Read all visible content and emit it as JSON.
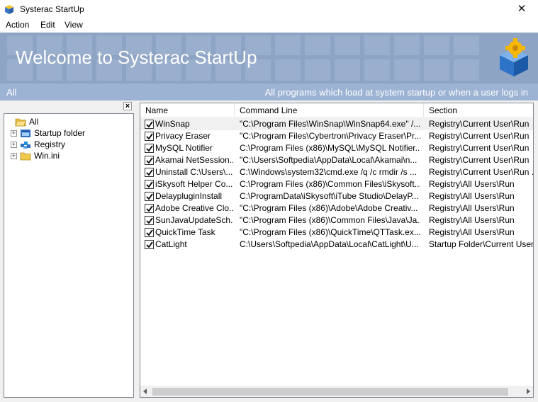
{
  "window": {
    "title": "Systerac StartUp",
    "close_label": "✕"
  },
  "menu": [
    "Action",
    "Edit",
    "View"
  ],
  "banner": {
    "title": "Welcome to Systerac StartUp",
    "bg_color": "#8ea4c4"
  },
  "subbar": {
    "left": "All",
    "right": "All programs which load at system startup or when a user logs in"
  },
  "tree": {
    "close_label": "×",
    "items": [
      {
        "label": "All",
        "icon": "folder-open-icon",
        "expandable": false
      },
      {
        "label": "Startup folder",
        "icon": "startup-folder-icon",
        "expandable": true
      },
      {
        "label": "Registry",
        "icon": "registry-icon",
        "expandable": true
      },
      {
        "label": "Win.ini",
        "icon": "folder-icon",
        "expandable": true
      }
    ]
  },
  "list": {
    "columns": [
      "Name",
      "Command Line",
      "Section"
    ],
    "rows": [
      {
        "checked": true,
        "name": "WinSnap",
        "command": "\"C:\\Program Files\\WinSnap\\WinSnap64.exe\" /...",
        "section": "Registry\\Current User\\Run"
      },
      {
        "checked": true,
        "name": "Privacy Eraser",
        "command": "\"C:\\Program Files\\Cybertron\\Privacy Eraser\\Pr...",
        "section": "Registry\\Current User\\Run"
      },
      {
        "checked": true,
        "name": "MySQL Notifier",
        "command": "C:\\Program Files (x86)\\MySQL\\MySQL Notifier...",
        "section": "Registry\\Current User\\Run"
      },
      {
        "checked": true,
        "name": "Akamai NetSession...",
        "command": "\"C:\\Users\\Softpedia\\AppData\\Local\\Akamai\\n...",
        "section": "Registry\\Current User\\Run"
      },
      {
        "checked": true,
        "name": "Uninstall C:\\Users\\...",
        "command": "C:\\Windows\\system32\\cmd.exe /q /c rmdir /s ...",
        "section": "Registry\\Current User\\Run ..."
      },
      {
        "checked": true,
        "name": "iSkysoft Helper Co...",
        "command": "C:\\Program Files (x86)\\Common Files\\iSkysoft...",
        "section": "Registry\\All Users\\Run"
      },
      {
        "checked": true,
        "name": "DelaypluginInstall",
        "command": "C:\\ProgramData\\iSkysoft\\iTube Studio\\DelayP...",
        "section": "Registry\\All Users\\Run"
      },
      {
        "checked": true,
        "name": "Adobe Creative Clo...",
        "command": "\"C:\\Program Files (x86)\\Adobe\\Adobe Creativ...",
        "section": "Registry\\All Users\\Run"
      },
      {
        "checked": true,
        "name": "SunJavaUpdateSch...",
        "command": "\"C:\\Program Files (x86)\\Common Files\\Java\\Ja...",
        "section": "Registry\\All Users\\Run"
      },
      {
        "checked": true,
        "name": "QuickTime Task",
        "command": "\"C:\\Program Files (x86)\\QuickTime\\QTTask.ex...",
        "section": "Registry\\All Users\\Run"
      },
      {
        "checked": true,
        "name": "CatLight",
        "command": "C:\\Users\\Softpedia\\AppData\\Local\\CatLight\\U...",
        "section": "Startup Folder\\Current User"
      }
    ]
  }
}
